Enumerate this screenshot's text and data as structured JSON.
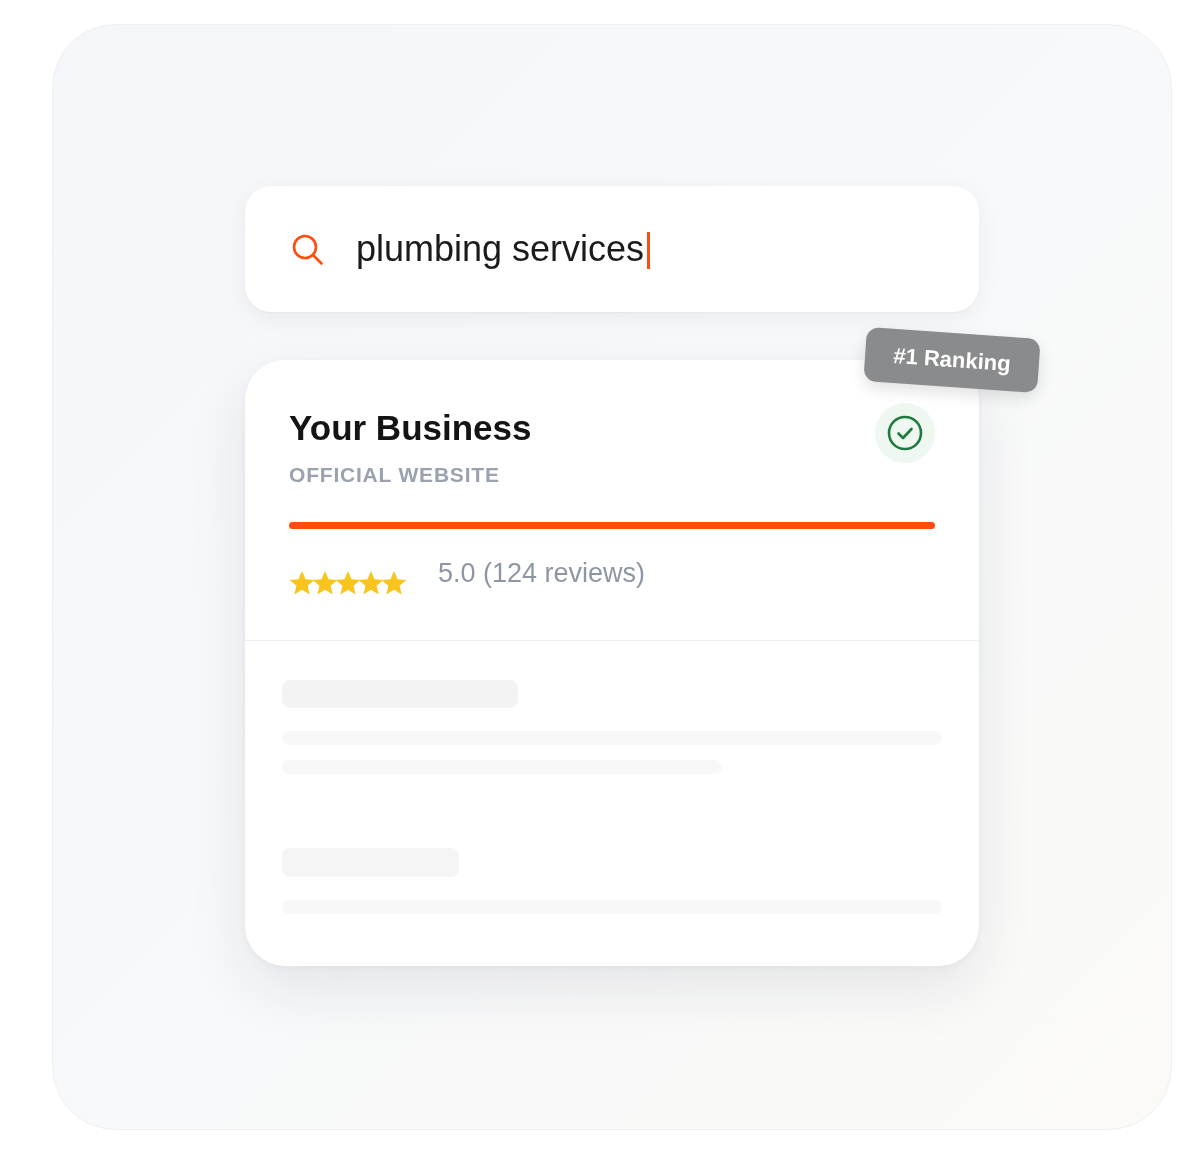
{
  "search": {
    "value": "plumbing services",
    "focused": true
  },
  "result": {
    "badge": "#1 Ranking",
    "title": "Your Business",
    "subtitle": "OFFICIAL WEBSITE",
    "verified": true,
    "stars": 5,
    "rating_text": "5.0 (124 reviews)"
  }
}
